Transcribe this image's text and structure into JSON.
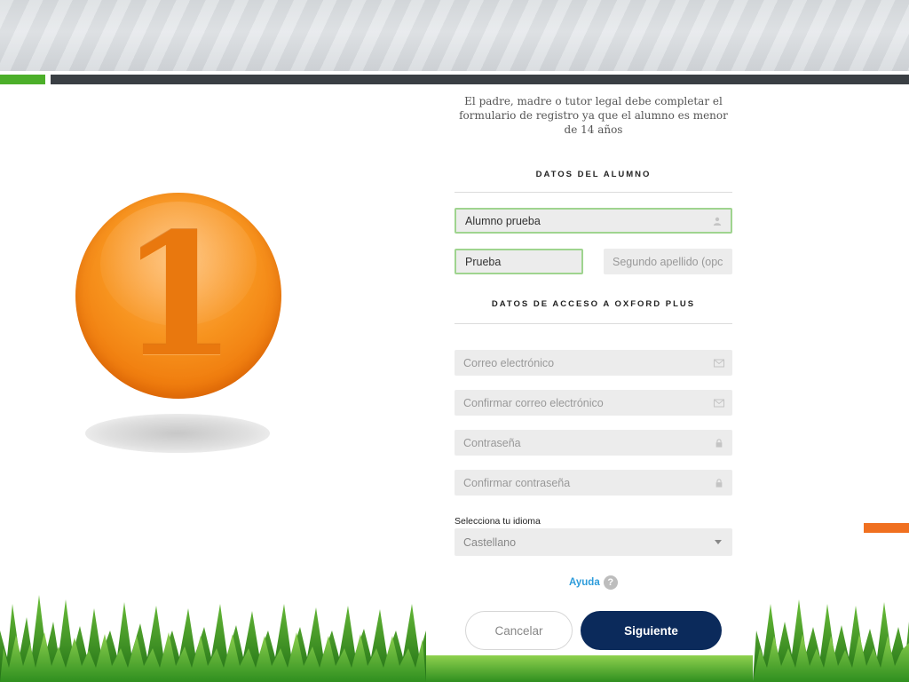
{
  "slide": {
    "step_number": "1",
    "colors": {
      "accent_green": "#4caf2a",
      "accent_dark": "#3a3f44",
      "accent_orange": "#f07020",
      "coin_orange": "#f7931e"
    }
  },
  "form": {
    "notice": "El padre, madre o tutor legal debe completar el formulario de registro ya que el alumno es menor de 14 años",
    "student_section_title": "DATOS DEL ALUMNO",
    "student_name_value": "Alumno prueba",
    "first_surname_value": "Prueba",
    "second_surname_placeholder": "Segundo apellido (opc",
    "access_section_title": "DATOS DE ACCESO A OXFORD PLUS",
    "email_placeholder": "Correo electrónico",
    "confirm_email_placeholder": "Confirmar correo electrónico",
    "password_placeholder": "Contraseña",
    "confirm_password_placeholder": "Confirmar contraseña",
    "language_label": "Selecciona tu idioma",
    "language_value": "Castellano",
    "help_text": "Ayuda",
    "help_icon_glyph": "?",
    "cancel_label": "Cancelar",
    "next_label": "Siguiente",
    "colors": {
      "filled_border": "#9fd48f",
      "help_link": "#2d9cdb",
      "next_button": "#0b2a5b"
    }
  }
}
